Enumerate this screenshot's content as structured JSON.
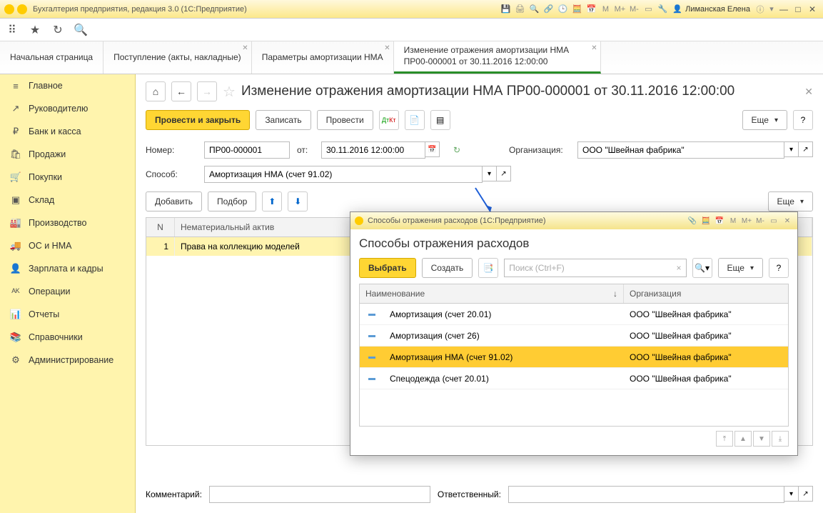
{
  "titlebar": {
    "app_title": "Бухгалтерия предприятия, редакция 3.0  (1С:Предприятие)",
    "user_name": "Лиманская Елена",
    "m_labels": [
      "M",
      "M+",
      "M-"
    ]
  },
  "tabs": [
    {
      "label": "Начальная страница",
      "closable": false
    },
    {
      "label": "Поступление (акты, накладные)",
      "closable": true
    },
    {
      "label": "Параметры амортизации НМА",
      "closable": true
    },
    {
      "label": "Изменение отражения амортизации НМА\nПР00-000001 от 30.11.2016 12:00:00",
      "closable": true,
      "active": true
    }
  ],
  "sidebar": {
    "items": [
      {
        "icon": "≡",
        "label": "Главное"
      },
      {
        "icon": "↗",
        "label": "Руководителю"
      },
      {
        "icon": "₽",
        "label": "Банк и касса"
      },
      {
        "icon": "🛍",
        "label": "Продажи"
      },
      {
        "icon": "🛒",
        "label": "Покупки"
      },
      {
        "icon": "▣",
        "label": "Склад"
      },
      {
        "icon": "🏭",
        "label": "Производство"
      },
      {
        "icon": "🚚",
        "label": "ОС и НМА"
      },
      {
        "icon": "👤",
        "label": "Зарплата и кадры"
      },
      {
        "icon": "ᴬᴷ",
        "label": "Операции"
      },
      {
        "icon": "📊",
        "label": "Отчеты"
      },
      {
        "icon": "📚",
        "label": "Справочники"
      },
      {
        "icon": "⚙",
        "label": "Администрирование"
      }
    ]
  },
  "document": {
    "title": "Изменение отражения амортизации НМА ПР00-000001 от 30.11.2016 12:00:00",
    "actions": {
      "post_close": "Провести и закрыть",
      "write": "Записать",
      "post": "Провести",
      "more": "Еще"
    },
    "fields": {
      "number_label": "Номер:",
      "number": "ПР00-000001",
      "date_label": "от:",
      "date": "30.11.2016 12:00:00",
      "org_label": "Организация:",
      "org": "ООО \"Швейная фабрика\"",
      "method_label": "Способ:",
      "method": "Амортизация НМА (счет 91.02)"
    },
    "table_toolbar": {
      "add": "Добавить",
      "pick": "Подбор",
      "more": "Еще"
    },
    "table": {
      "col_n": "N",
      "col_name": "Нематериальный актив",
      "rows": [
        {
          "n": "1",
          "name": "Права на коллекцию моделей"
        }
      ]
    },
    "footer": {
      "comment_label": "Комментарий:",
      "comment": "",
      "responsible_label": "Ответственный:",
      "responsible": ""
    }
  },
  "popup": {
    "window_title": "Способы отражения расходов  (1С:Предприятие)",
    "heading": "Способы отражения расходов",
    "actions": {
      "select": "Выбрать",
      "create": "Создать",
      "more": "Еще"
    },
    "search_placeholder": "Поиск (Ctrl+F)",
    "columns": {
      "name": "Наименование",
      "org": "Организация"
    },
    "rows": [
      {
        "name": "Амортизация (счет 20.01)",
        "org": "ООО \"Швейная фабрика\""
      },
      {
        "name": "Амортизация (счет 26)",
        "org": "ООО \"Швейная фабрика\""
      },
      {
        "name": "Амортизация НМА (счет 91.02)",
        "org": "ООО \"Швейная фабрика\"",
        "selected": true
      },
      {
        "name": "Спецодежда (счет 20.01)",
        "org": "ООО \"Швейная фабрика\""
      }
    ],
    "m_labels": [
      "M",
      "M+",
      "M-"
    ]
  }
}
